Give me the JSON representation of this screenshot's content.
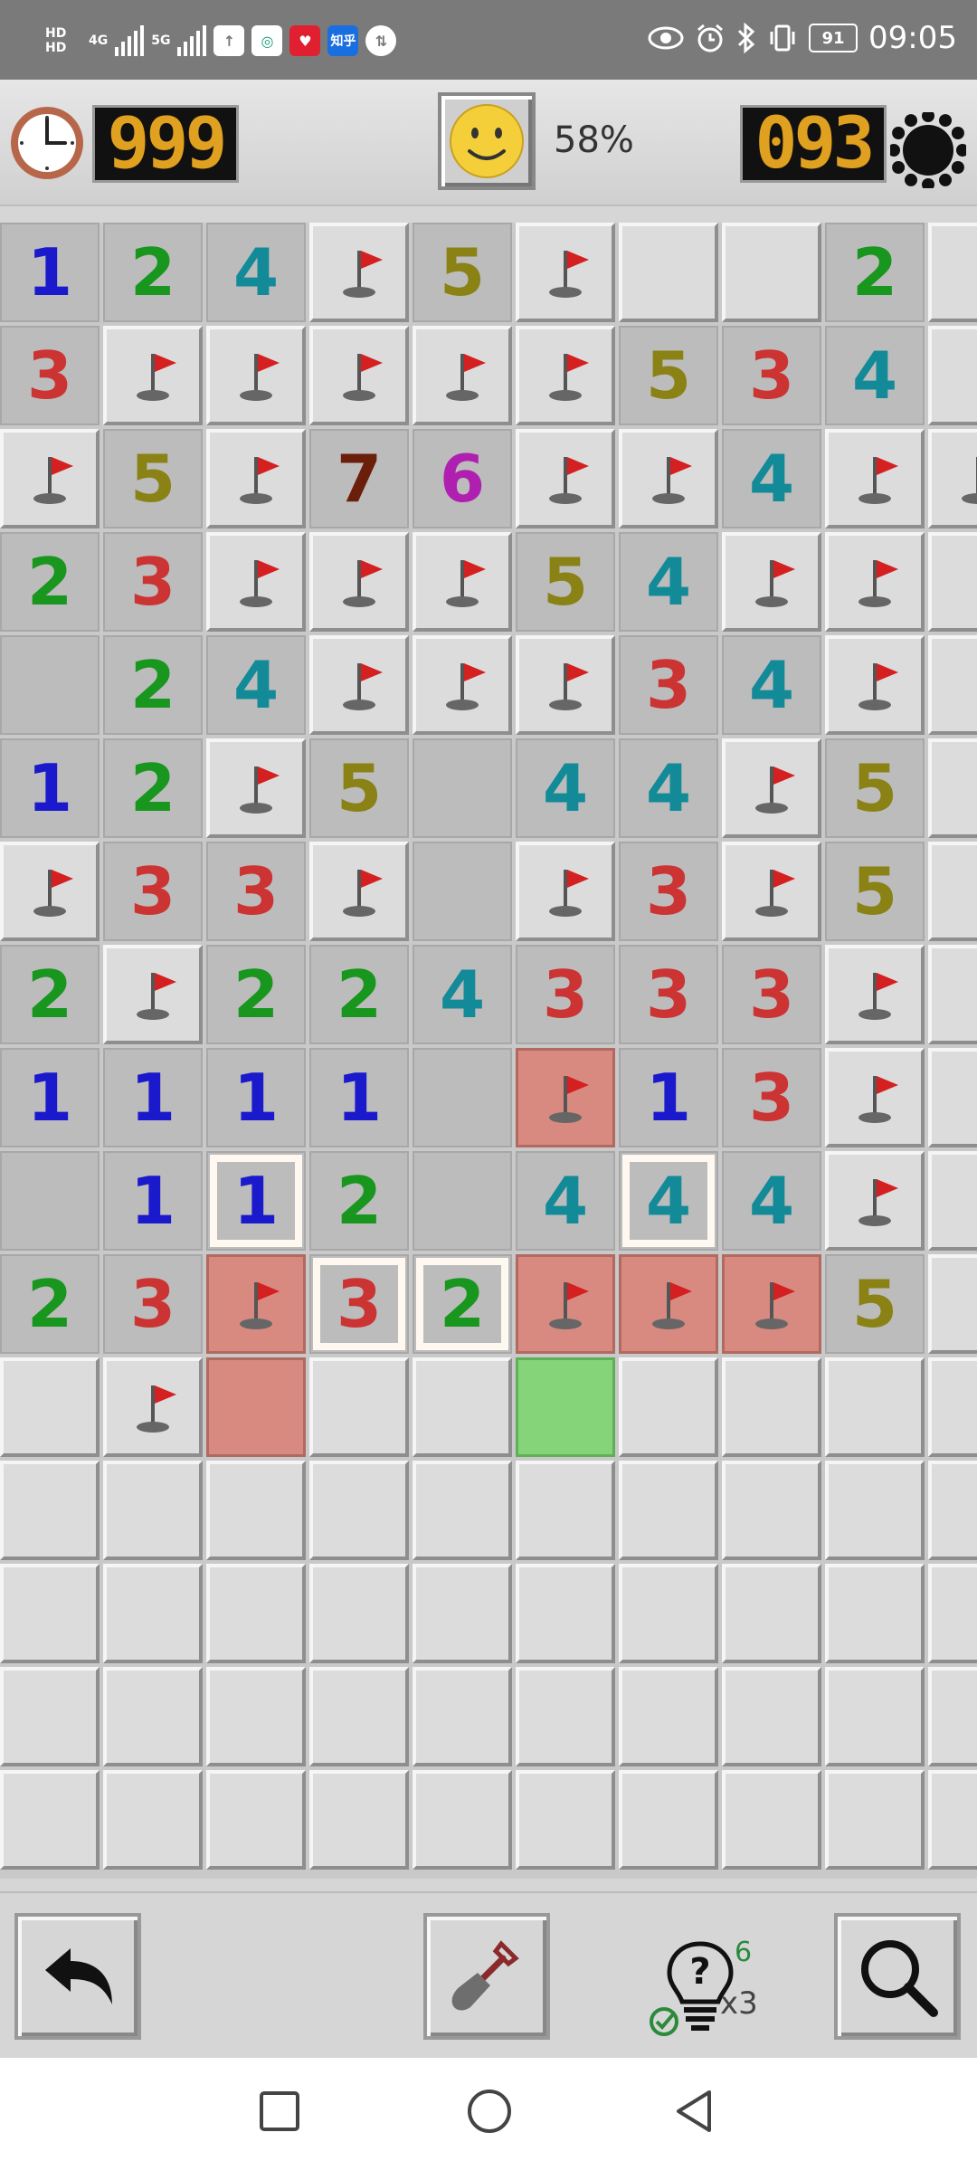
{
  "status_bar": {
    "hd1": "HD",
    "hd2": "HD",
    "net1": "4G",
    "net2": "5G",
    "app_icons": [
      "upload-icon",
      "china-mobile-icon",
      "heart-app-icon",
      "zhihu-icon",
      "hotspot-icon"
    ],
    "zhihu_label": "知乎",
    "battery": "91",
    "time": "09:05"
  },
  "header": {
    "timer": "999",
    "percent": "58%",
    "mines_remaining": "093"
  },
  "colors": {
    "1": "#1a1acc",
    "2": "#18961e",
    "3": "#cc3333",
    "4": "#138a98",
    "5": "#8a8214",
    "6": "#b020b0",
    "7": "#6b1e0a",
    "flag": "#d42020",
    "mine_cell": "#d98a80",
    "highlight_cell": "#86d47a"
  },
  "board": {
    "cols": 10,
    "rows": [
      [
        "1",
        "2",
        "4",
        "F",
        "5",
        "F",
        "C",
        "C",
        "2",
        "C"
      ],
      [
        "3",
        "F",
        "F",
        "F",
        "F",
        "F",
        "5",
        "3",
        "4",
        "C"
      ],
      [
        "F",
        "5",
        "F",
        "7",
        "6",
        "F",
        "F",
        "4",
        "F",
        "F"
      ],
      [
        "2",
        "3",
        "F",
        "F",
        "F",
        "5",
        "4",
        "F",
        "F",
        "C"
      ],
      [
        "E",
        "2",
        "4",
        "F",
        "F",
        "F",
        "3",
        "4",
        "F",
        "C"
      ],
      [
        "1",
        "2",
        "F",
        "5",
        "E",
        "4",
        "4",
        "F",
        "5",
        "C"
      ],
      [
        "F",
        "3",
        "3",
        "F",
        "E",
        "F",
        "3",
        "F",
        "5",
        "C"
      ],
      [
        "2",
        "F",
        "2",
        "2",
        "4",
        "3",
        "3",
        "3",
        "F",
        "C"
      ],
      [
        "1",
        "1",
        "1",
        "1",
        "E",
        "MF",
        "1",
        "3",
        "F",
        "C"
      ],
      [
        "E",
        "1",
        "1*",
        "2",
        "E",
        "4",
        "4*",
        "4",
        "F",
        "C"
      ],
      [
        "2",
        "3",
        "MF",
        "3*",
        "2*",
        "MF",
        "MF",
        "MF",
        "5",
        "C"
      ],
      [
        "C",
        "F",
        "M",
        "C",
        "C",
        "G",
        "C",
        "C",
        "C",
        "C"
      ],
      [
        "C",
        "C",
        "C",
        "C",
        "C",
        "C",
        "C",
        "C",
        "C",
        "C"
      ],
      [
        "C",
        "C",
        "C",
        "C",
        "C",
        "C",
        "C",
        "C",
        "C",
        "C"
      ],
      [
        "C",
        "C",
        "C",
        "C",
        "C",
        "C",
        "C",
        "C",
        "C",
        "C"
      ],
      [
        "C",
        "C",
        "C",
        "C",
        "C",
        "C",
        "C",
        "C",
        "C",
        "C"
      ]
    ]
  },
  "toolbar": {
    "undo_icon": "undo-arrow-icon",
    "dig_icon": "shovel-icon",
    "hint_count": "6",
    "hint_multiplier": "x3",
    "zoom_icon": "magnifier-icon"
  },
  "nav_bar": [
    "square-recent-icon",
    "circle-home-icon",
    "triangle-back-icon"
  ]
}
